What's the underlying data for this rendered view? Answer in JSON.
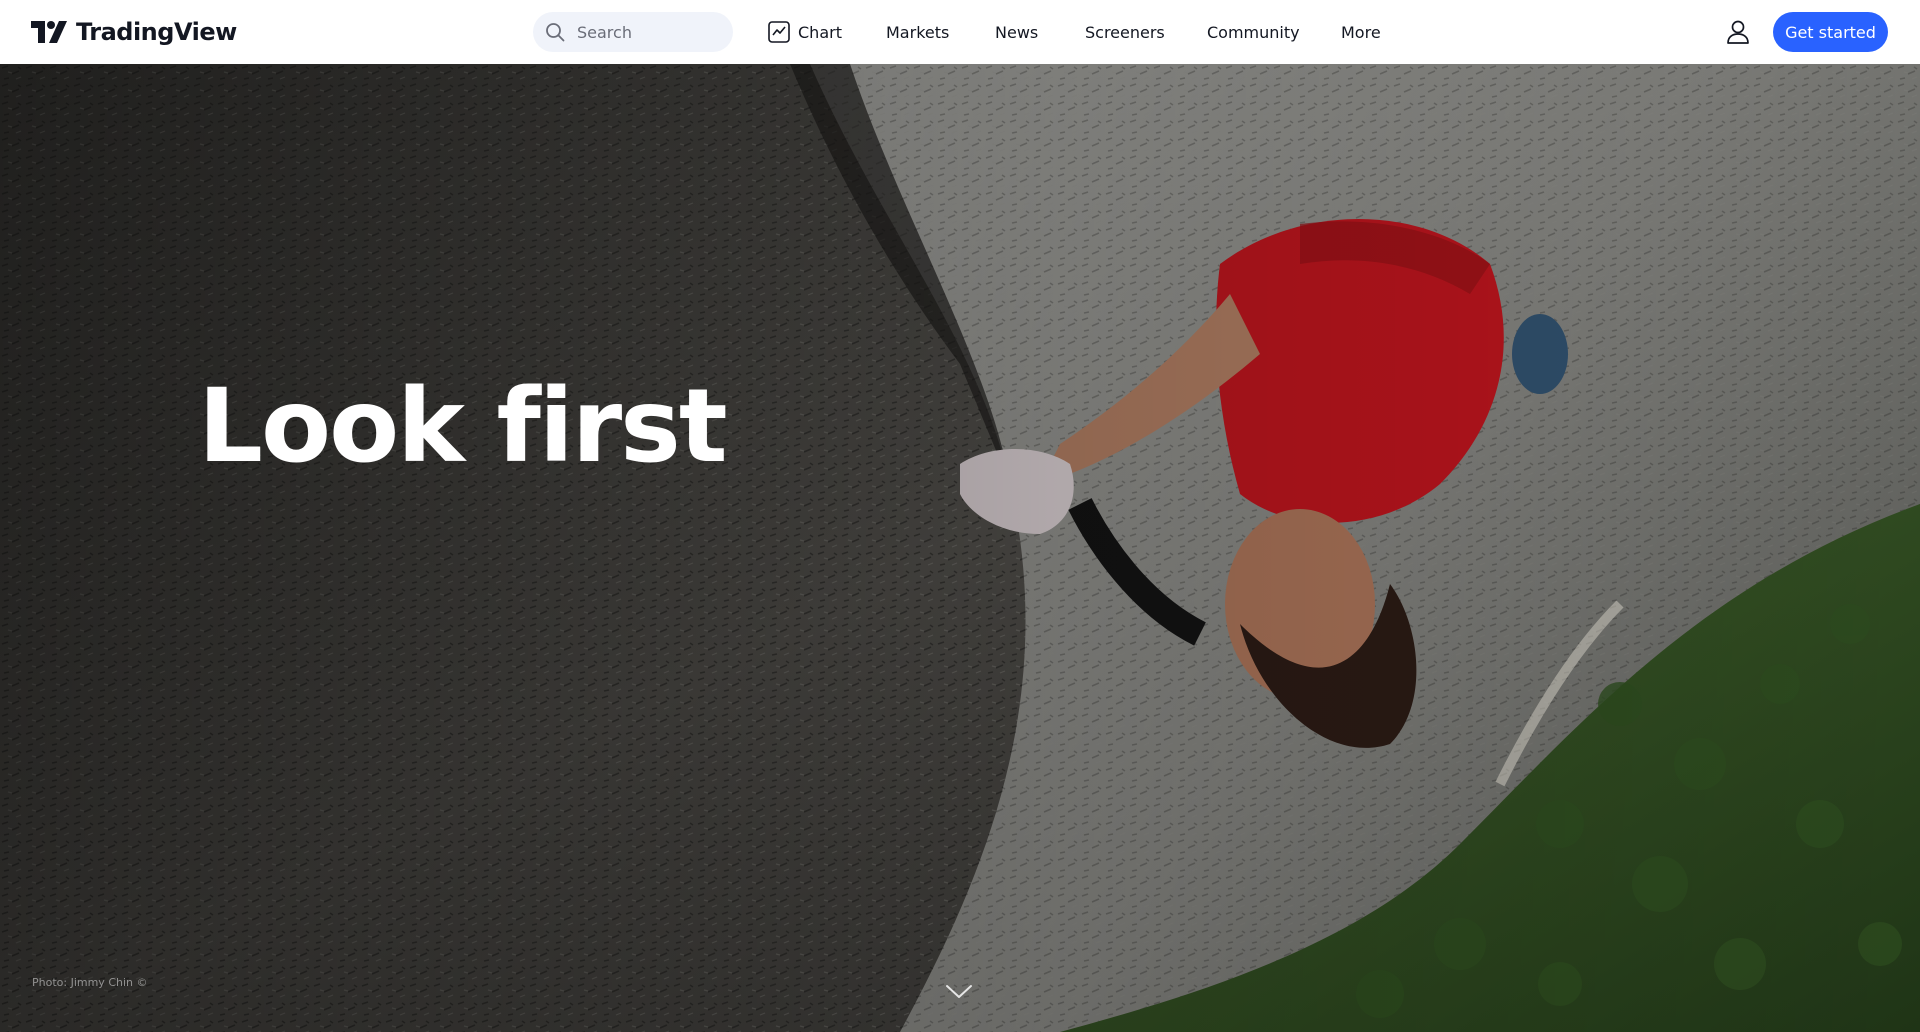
{
  "header": {
    "logo_text": "TradingView",
    "search": {
      "placeholder": "Search"
    },
    "nav": [
      {
        "label": "Chart"
      },
      {
        "label": "Markets"
      },
      {
        "label": "News"
      },
      {
        "label": "Screeners"
      },
      {
        "label": "Community"
      },
      {
        "label": "More"
      }
    ],
    "cta_label": "Get started"
  },
  "hero": {
    "headline": "Look first",
    "photo_credit": "Photo: Jimmy Chin ©"
  },
  "colors": {
    "accent": "#2962ff",
    "text": "#131722",
    "search_bg": "#f0f3fa"
  },
  "icons": {
    "logo": "tradingview-logo-icon",
    "search": "search-icon",
    "chart": "chart-icon",
    "user": "user-icon",
    "scroll": "chevron-down-icon"
  }
}
